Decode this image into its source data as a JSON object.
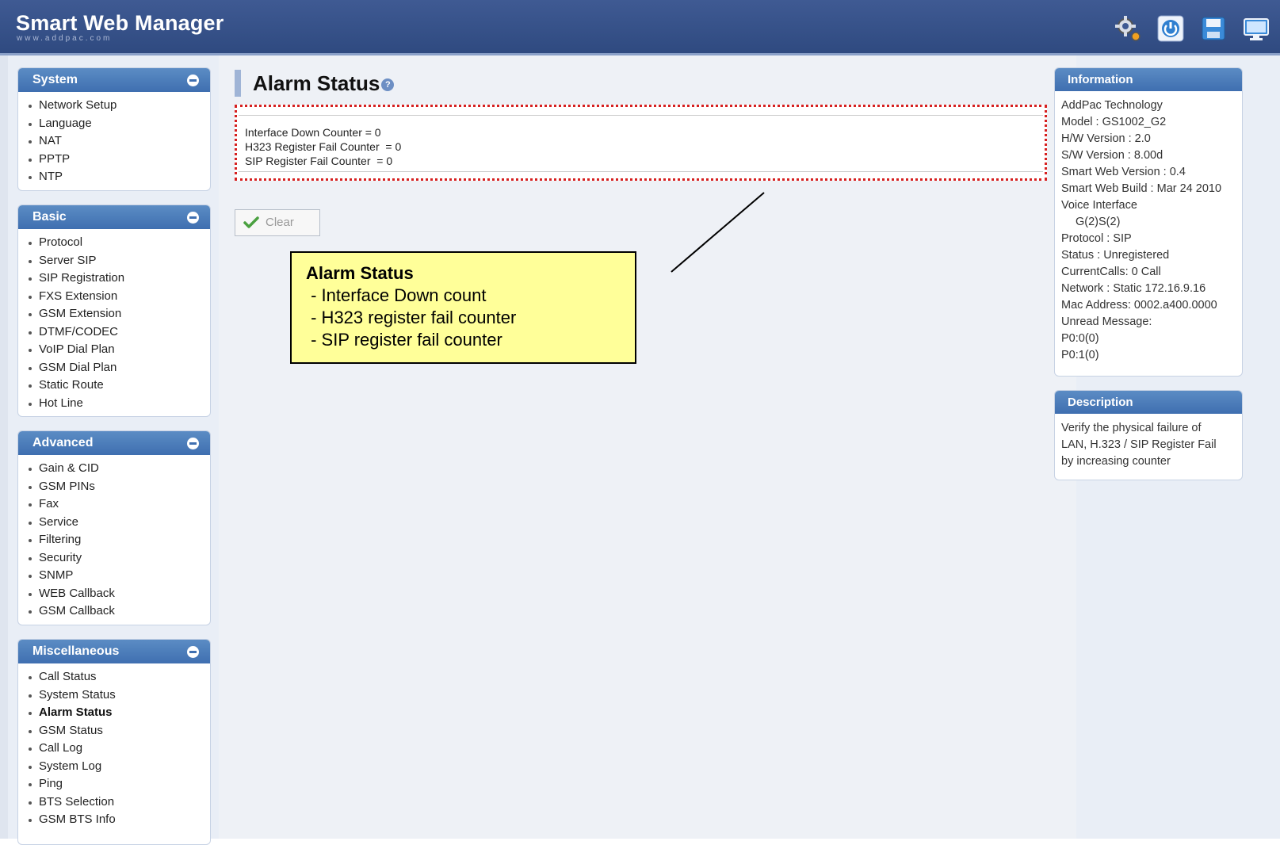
{
  "header": {
    "title": "Smart Web Manager",
    "subtitle": "www.addpac.com",
    "icons": [
      "settings-icon",
      "power-icon",
      "save-icon",
      "monitor-icon"
    ]
  },
  "sidebar": {
    "sections": [
      {
        "title": "System",
        "items": [
          "Network Setup",
          "Language",
          "NAT",
          "PPTP",
          "NTP"
        ]
      },
      {
        "title": "Basic",
        "items": [
          "Protocol",
          "Server SIP",
          "SIP Registration",
          "FXS Extension",
          "GSM Extension",
          "DTMF/CODEC",
          "VoIP Dial Plan",
          "GSM Dial Plan",
          "Static Route",
          "Hot Line"
        ]
      },
      {
        "title": "Advanced",
        "items": [
          "Gain & CID",
          "GSM PINs",
          "Fax",
          "Service",
          "Filtering",
          "Security",
          "SNMP",
          "WEB Callback",
          "GSM Callback"
        ]
      },
      {
        "title": "Miscellaneous",
        "items": [
          "Call Status",
          "System Status",
          "Alarm Status",
          "GSM Status",
          "Call Log",
          "System Log",
          "Ping",
          "BTS Selection",
          "GSM BTS Info"
        ]
      }
    ]
  },
  "main": {
    "title": "Alarm Status",
    "help_glyph": "?",
    "status_lines": [
      "Interface Down Counter = 0",
      "H323 Register Fail Counter  = 0",
      "SIP Register Fail Counter  = 0"
    ],
    "clear_label": "Clear"
  },
  "callout": {
    "title": "Alarm Status",
    "items": [
      " - Interface Down count",
      " - H323 register fail counter",
      " - SIP register fail counter"
    ]
  },
  "information": {
    "title": "Information",
    "lines": [
      "AddPac Technology",
      "Model : GS1002_G2",
      "H/W Version : 2.0",
      "S/W Version : 8.00d",
      "Smart Web Version : 0.4",
      "Smart Web Build : Mar 24 2010",
      "Voice Interface",
      "G(2)S(2)",
      "Protocol : SIP",
      "Status : Unregistered",
      "CurrentCalls: 0 Call",
      "Network : Static 172.16.9.16",
      "Mac Address: 0002.a400.0000",
      "Unread Message:",
      "P0:0(0)",
      "P0:1(0)"
    ]
  },
  "description": {
    "title": "Description",
    "lines": [
      "Verify the physical failure of",
      "LAN, H.323 / SIP Register Fail",
      "by increasing counter"
    ]
  }
}
